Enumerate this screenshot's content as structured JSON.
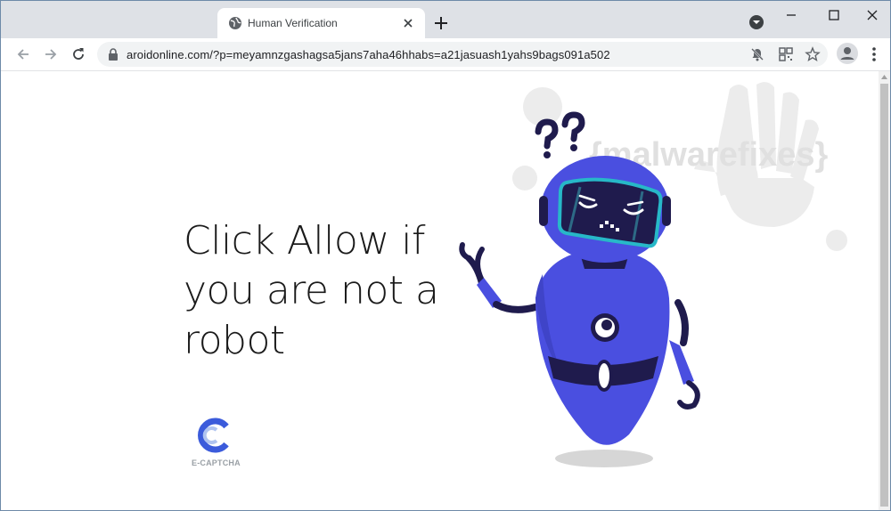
{
  "browser": {
    "tab_title": "Human Verification",
    "url": "aroidonline.com/?p=meyamnzgashagsa5jans7aha46hhabs=a21jasuash1yahs9bags091a502"
  },
  "page": {
    "headline": "Click Allow if you are not a robot",
    "captcha_label": "E-CAPTCHA",
    "watermark_text": "{malwarefixes}"
  },
  "colors": {
    "robot_body": "#4a4fe0",
    "robot_dark": "#1f1b4d",
    "visor": "#27b8c8",
    "captcha_blue": "#3b5bdb"
  },
  "icons": [
    "globe-icon",
    "close-icon",
    "plus-icon",
    "back-icon",
    "forward-icon",
    "reload-icon",
    "lock-icon",
    "notifications-blocked-icon",
    "qr-icon",
    "star-icon",
    "profile-icon",
    "menu-icon"
  ]
}
